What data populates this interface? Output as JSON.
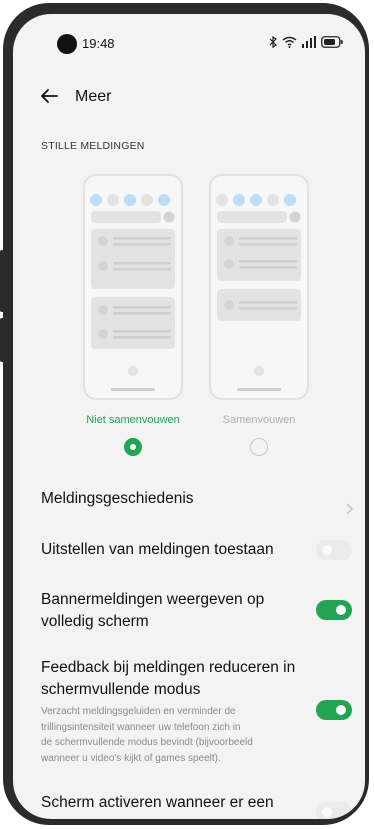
{
  "status": {
    "time": "19:48"
  },
  "appbar": {
    "title": "Meer"
  },
  "section": {
    "label": "STILLE MELDINGEN"
  },
  "options": [
    {
      "label": "Niet samenvouwen",
      "selected": true
    },
    {
      "label": "Samenvouwen",
      "selected": false
    }
  ],
  "settings": [
    {
      "title": "Meldingsgeschiedenis",
      "control": "chevron"
    },
    {
      "title": "Uitstellen van meldingen toestaan",
      "control": "toggle",
      "on": false
    },
    {
      "title_lines": [
        "Bannermeldingen weergeven op",
        "volledig scherm"
      ],
      "control": "toggle",
      "on": true
    },
    {
      "title_lines": [
        "Feedback bij meldingen reduceren in",
        "schermvullende modus"
      ],
      "subtitle_lines": [
        "Verzacht meldingsgeluiden en verminder de",
        "trillingsintensiteit wanneer uw telefoon zich in",
        "de schermvullende modus bevindt (bijvoorbeeld",
        "wanneer u video's kijkt of games speelt)."
      ],
      "control": "toggle",
      "on": true
    },
    {
      "title": "Scherm activeren wanneer er een",
      "control": "toggle",
      "on": false
    }
  ],
  "colors": {
    "accent": "#23a455",
    "placeholder_blue": "#bcdcf8",
    "placeholder_grey": "#e3e3e3"
  }
}
